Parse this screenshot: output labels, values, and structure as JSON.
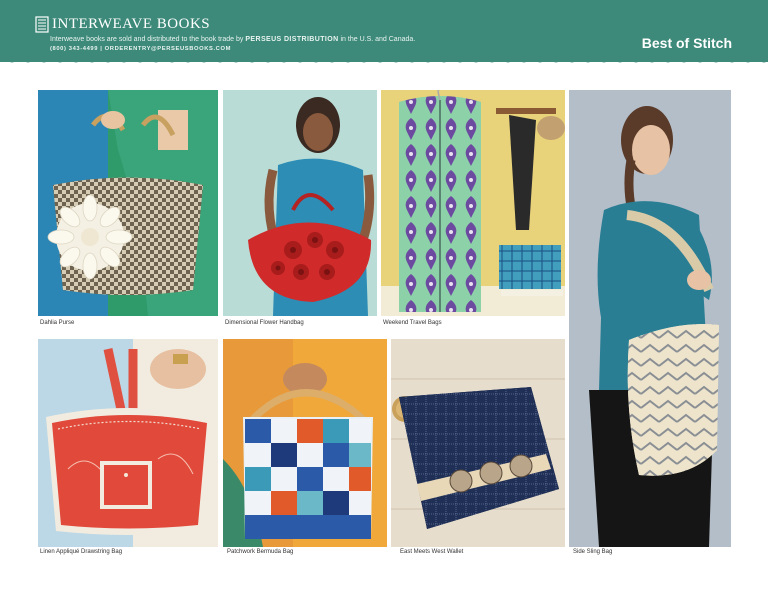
{
  "header": {
    "brand": "INTERWEAVE BOOKS",
    "tagline_prefix": "Interweave books are sold and distributed to the book trade by",
    "tagline_distributor": "PERSEUS DISTRIBUTION",
    "tagline_suffix": "in the U.S. and Canada.",
    "contact": "(800) 343-4499  |  ORDERENTRY@PERSEUSBOOKS.COM",
    "section_title": "Best of Stitch",
    "color": "#3d8a7a"
  },
  "products": [
    {
      "caption": "Dahlia Purse"
    },
    {
      "caption": "Dimensional Flower Handbag"
    },
    {
      "caption": "Weekend Travel Bags"
    },
    {
      "caption": "Linen Appliqué Drawstring Bag"
    },
    {
      "caption": "Patchwork Bermuda Bag"
    },
    {
      "caption": "East Meets West Wallet"
    },
    {
      "caption": "Side Sling Bag"
    }
  ]
}
